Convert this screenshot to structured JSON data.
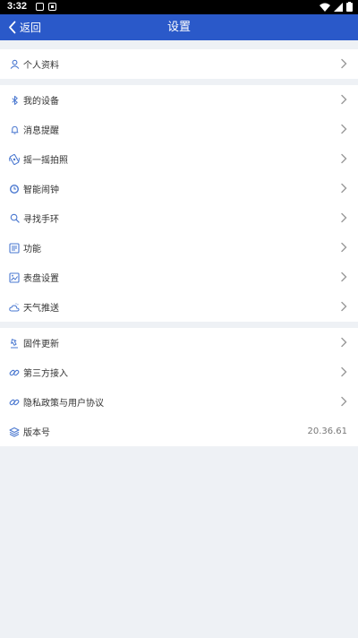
{
  "status_bar": {
    "time": "3:32"
  },
  "app_bar": {
    "back_label": "返回",
    "title": "设置"
  },
  "sections": [
    {
      "items": [
        {
          "label": "个人资料",
          "icon": "person-icon"
        }
      ]
    },
    {
      "items": [
        {
          "label": "我的设备",
          "icon": "bluetooth-icon"
        },
        {
          "label": "消息提醒",
          "icon": "bell-icon"
        },
        {
          "label": "摇一摇拍照",
          "icon": "shake-phone-icon"
        },
        {
          "label": "智能闹钟",
          "icon": "alarm-clock-icon"
        },
        {
          "label": "寻找手环",
          "icon": "search-icon"
        },
        {
          "label": "功能",
          "icon": "function-list-icon"
        },
        {
          "label": "表盘设置",
          "icon": "watch-face-icon"
        },
        {
          "label": "天气推送",
          "icon": "weather-cloud-icon"
        }
      ]
    },
    {
      "items": [
        {
          "label": "固件更新",
          "icon": "firmware-update-icon"
        },
        {
          "label": "第三方接入",
          "icon": "link-icon"
        },
        {
          "label": "隐私政策与用户协议",
          "icon": "link-icon"
        },
        {
          "label": "版本号",
          "icon": "layers-icon",
          "value": "20.36.61"
        }
      ]
    }
  ],
  "colors": {
    "app_bar": "#2a59c9",
    "icon_blue": "#4a78d0",
    "background": "#eef1f5"
  }
}
